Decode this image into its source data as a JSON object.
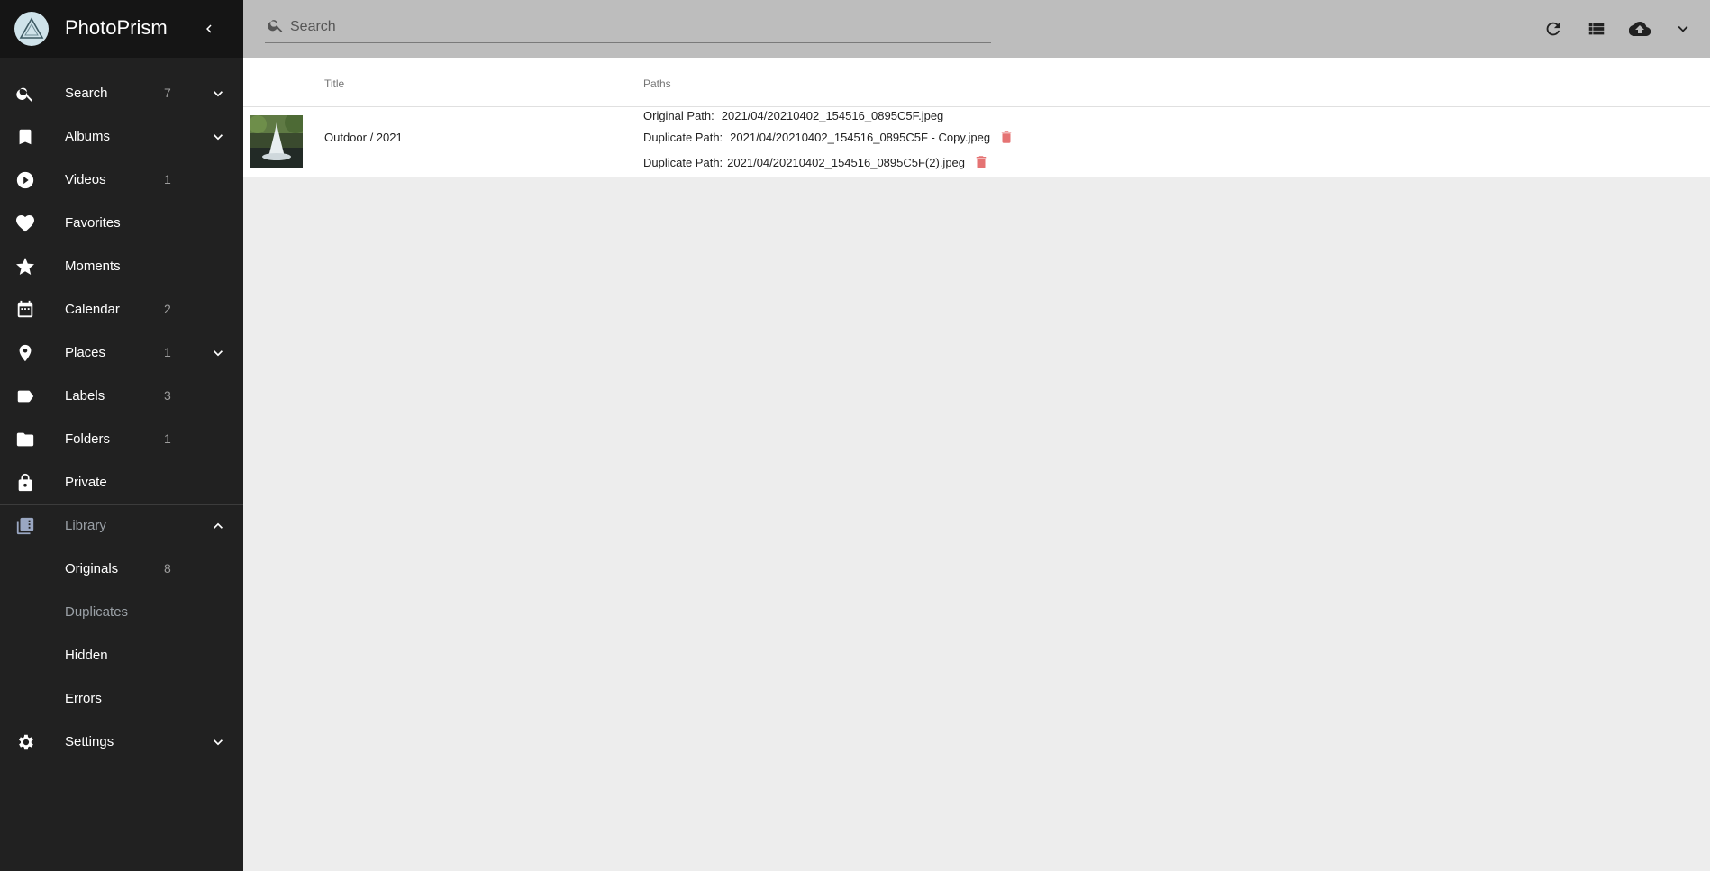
{
  "app": {
    "title": "PhotoPrism"
  },
  "colors": {
    "sidebar": "#212121",
    "topbar": "#bdbdbd",
    "delete": "#e57373"
  },
  "sidebar": {
    "items": [
      {
        "label": "Search",
        "count": "7",
        "icon": "search-icon"
      },
      {
        "label": "Albums",
        "count": "",
        "icon": "bookmark-icon"
      },
      {
        "label": "Videos",
        "count": "1",
        "icon": "play-circle-icon"
      },
      {
        "label": "Favorites",
        "count": "",
        "icon": "heart-icon"
      },
      {
        "label": "Moments",
        "count": "",
        "icon": "star-icon"
      },
      {
        "label": "Calendar",
        "count": "2",
        "icon": "calendar-icon"
      },
      {
        "label": "Places",
        "count": "1",
        "icon": "place-icon"
      },
      {
        "label": "Labels",
        "count": "3",
        "icon": "label-icon"
      },
      {
        "label": "Folders",
        "count": "1",
        "icon": "folder-icon"
      },
      {
        "label": "Private",
        "count": "",
        "icon": "lock-icon"
      }
    ],
    "library": {
      "label": "Library",
      "sub": [
        {
          "label": "Originals",
          "count": "8"
        },
        {
          "label": "Duplicates",
          "count": ""
        },
        {
          "label": "Hidden",
          "count": ""
        },
        {
          "label": "Errors",
          "count": ""
        }
      ]
    },
    "settings": {
      "label": "Settings"
    }
  },
  "search": {
    "placeholder": "Search"
  },
  "table": {
    "headers": {
      "title": "Title",
      "paths": "Paths"
    },
    "rows": [
      {
        "title": "Outdoor / 2021",
        "original_label": "Original Path:",
        "original_path": "2021/04/20210402_154516_0895C5F.jpeg",
        "duplicates": [
          {
            "label": "Duplicate Path:",
            "path": "2021/04/20210402_154516_0895C5F - Copy.jpeg"
          },
          {
            "label": "Duplicate Path:",
            "path": "2021/04/20210402_154516_0895C5F(2).jpeg"
          }
        ]
      }
    ]
  }
}
